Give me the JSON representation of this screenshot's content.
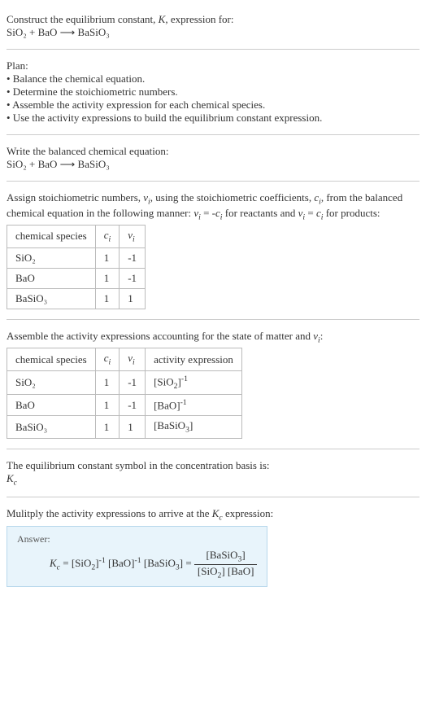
{
  "intro": {
    "line1": "Construct the equilibrium constant, K, expression for:",
    "equation": "SiO₂ + BaO ⟶ BaSiO₃"
  },
  "plan": {
    "heading": "Plan:",
    "items": [
      "• Balance the chemical equation.",
      "• Determine the stoichiometric numbers.",
      "• Assemble the activity expression for each chemical species.",
      "• Use the activity expressions to build the equilibrium constant expression."
    ]
  },
  "balanced": {
    "line1": "Write the balanced chemical equation:",
    "equation": "SiO₂ + BaO ⟶ BaSiO₃"
  },
  "assign": {
    "text": "Assign stoichiometric numbers, νᵢ, using the stoichiometric coefficients, cᵢ, from the balanced chemical equation in the following manner: νᵢ = -cᵢ for reactants and νᵢ = cᵢ for products:",
    "headers": [
      "chemical species",
      "cᵢ",
      "νᵢ"
    ],
    "rows": [
      {
        "species": "SiO₂",
        "c": "1",
        "v": "-1"
      },
      {
        "species": "BaO",
        "c": "1",
        "v": "-1"
      },
      {
        "species": "BaSiO₃",
        "c": "1",
        "v": "1"
      }
    ]
  },
  "activity": {
    "text": "Assemble the activity expressions accounting for the state of matter and νᵢ:",
    "headers": [
      "chemical species",
      "cᵢ",
      "νᵢ",
      "activity expression"
    ],
    "rows": [
      {
        "species": "SiO₂",
        "c": "1",
        "v": "-1",
        "expr": "[SiO₂]⁻¹"
      },
      {
        "species": "BaO",
        "c": "1",
        "v": "-1",
        "expr": "[BaO]⁻¹"
      },
      {
        "species": "BaSiO₃",
        "c": "1",
        "v": "1",
        "expr": "[BaSiO₃]"
      }
    ]
  },
  "symbol": {
    "line1": "The equilibrium constant symbol in the concentration basis is:",
    "line2": "K𝒸"
  },
  "multiply": {
    "text": "Mulitply the activity expressions to arrive at the K𝒸 expression:"
  },
  "answer": {
    "label": "Answer:",
    "lhs": "K𝒸 = [SiO₂]⁻¹ [BaO]⁻¹ [BaSiO₃] =",
    "num": "[BaSiO₃]",
    "den": "[SiO₂] [BaO]"
  }
}
